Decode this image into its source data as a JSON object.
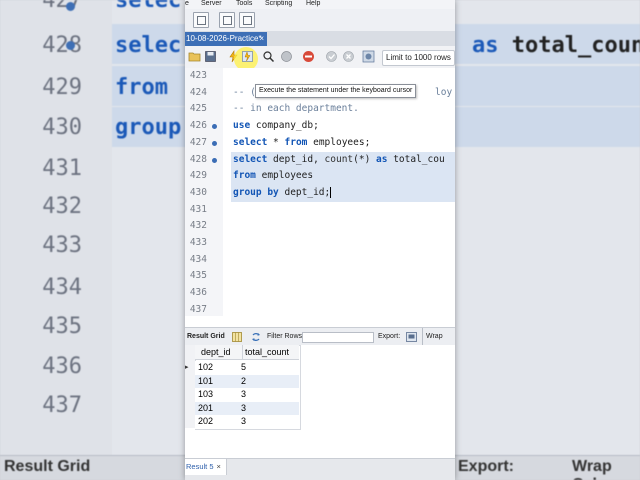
{
  "menu": [
    "e",
    "Server",
    "Tools",
    "Scripting",
    "Help"
  ],
  "tab": {
    "title": "10-08-2026-Practice*",
    "close": "×"
  },
  "sql_toolbar": {
    "limit_label": "Limit to 1000 rows"
  },
  "tooltip": "Execute the statement under the keyboard cursor",
  "editor": {
    "lines": [
      {
        "num": "423",
        "text": ""
      },
      {
        "num": "424",
        "text": "-- ("
      },
      {
        "num": "425",
        "text": "-- in each department."
      },
      {
        "num": "426",
        "text": "use company_db;"
      },
      {
        "num": "427",
        "text": "select * from employees;"
      },
      {
        "num": "428",
        "text": "select dept_id, count(*) as total_cou"
      },
      {
        "num": "429",
        "text": "from employees"
      },
      {
        "num": "430",
        "text": "group by dept_id;"
      },
      {
        "num": "431",
        "text": ""
      },
      {
        "num": "432",
        "text": ""
      },
      {
        "num": "433",
        "text": ""
      },
      {
        "num": "434",
        "text": ""
      },
      {
        "num": "435",
        "text": ""
      },
      {
        "num": "436",
        "text": ""
      },
      {
        "num": "437",
        "text": ""
      }
    ],
    "comment_tail": "loy"
  },
  "results_toolbar": {
    "result_grid": "Result Grid",
    "filter_rows": "Filter Rows:",
    "export": "Export:",
    "wrap": "Wrap Cel"
  },
  "results": {
    "columns": [
      "dept_id",
      "total_count"
    ],
    "rows": [
      [
        "102",
        "5"
      ],
      [
        "101",
        "2"
      ],
      [
        "103",
        "3"
      ],
      [
        "201",
        "3"
      ],
      [
        "202",
        "3"
      ]
    ]
  },
  "bottom_tab": {
    "label": "Result 5",
    "close": "×"
  },
  "background": {
    "lines": [
      {
        "num": "427",
        "text": "selec"
      },
      {
        "num": "428",
        "text": "selec",
        "tail": "as total_coun"
      },
      {
        "num": "429",
        "text": "from"
      },
      {
        "num": "430",
        "text": "group"
      },
      {
        "num": "431",
        "text": ""
      },
      {
        "num": "432",
        "text": ""
      },
      {
        "num": "433",
        "text": ""
      },
      {
        "num": "434",
        "text": ""
      },
      {
        "num": "435",
        "text": ""
      },
      {
        "num": "436",
        "text": ""
      },
      {
        "num": "437",
        "text": ""
      }
    ],
    "result_grid": "Result Grid",
    "export": "Export:",
    "wrap": "Wrap Cel"
  }
}
